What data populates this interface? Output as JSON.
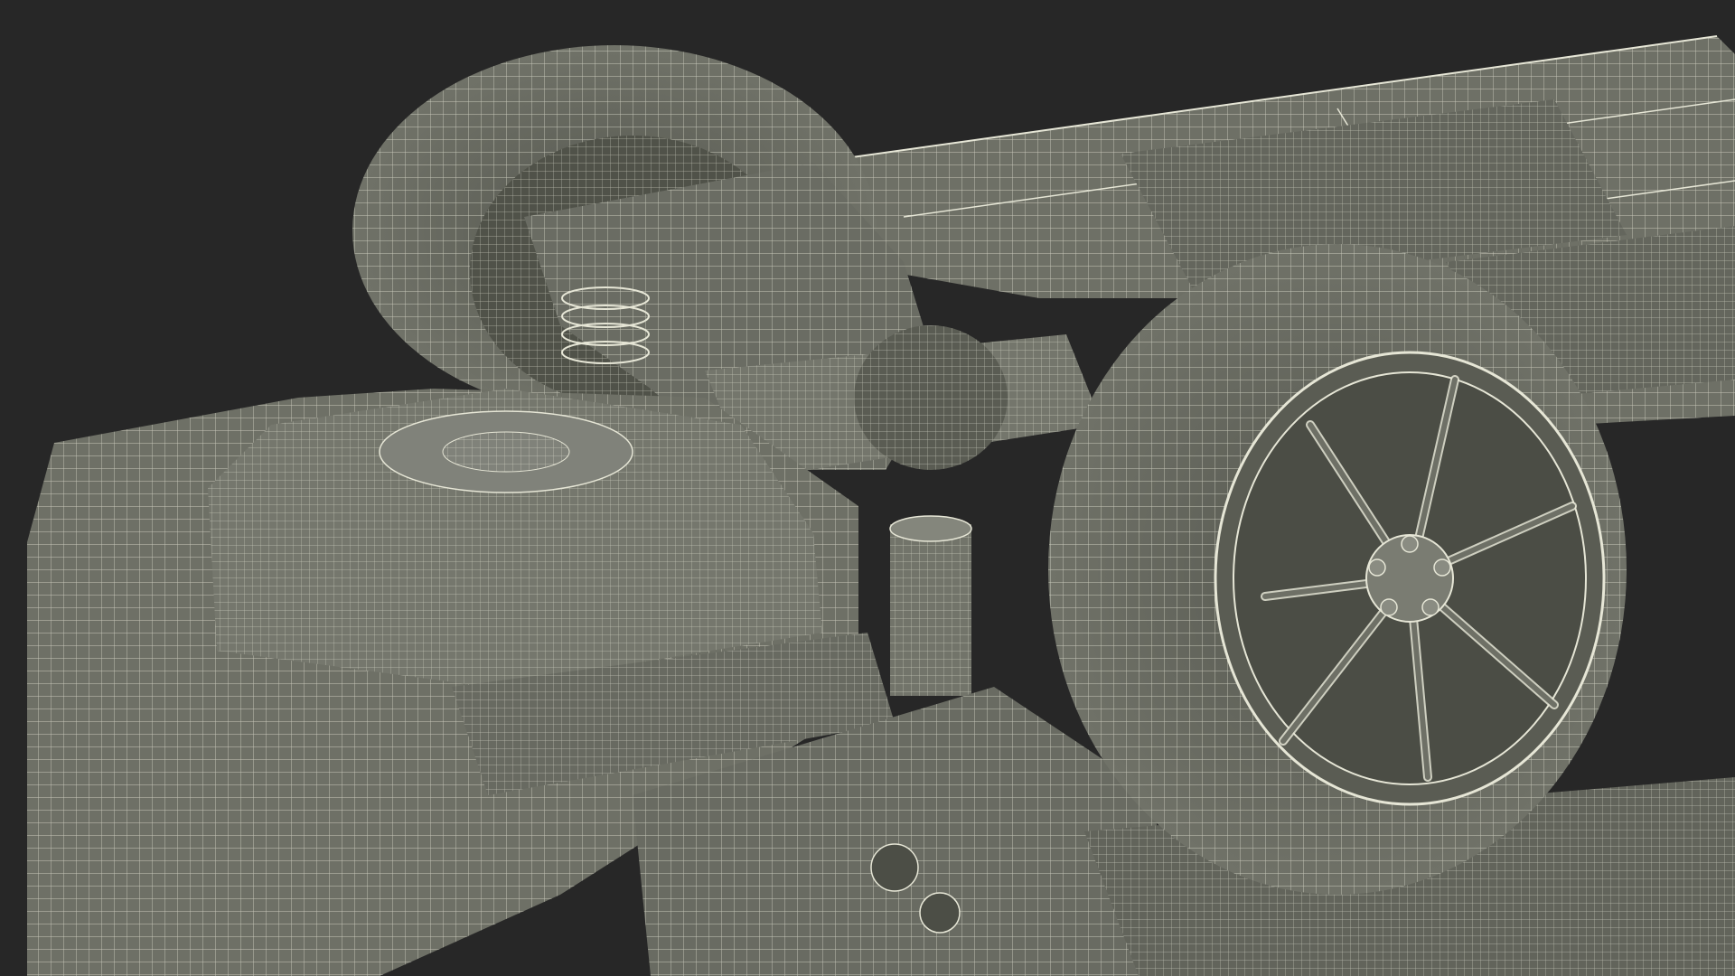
{
  "scene": {
    "background_color": "#272727",
    "mesh_fill_color": "#6e7066",
    "mesh_fill_dark": "#55574f",
    "mesh_fill_light": "#8a8c82",
    "wire_color": "#e6e6d6",
    "subject_icon": "car-chassis-wireframe-icon"
  }
}
